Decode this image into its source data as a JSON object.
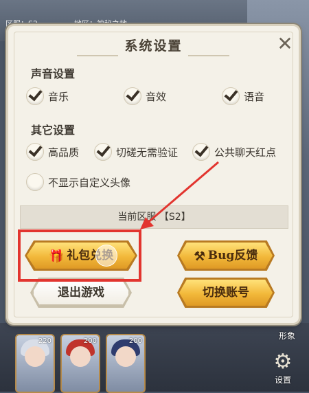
{
  "header": {
    "server_label": "区服：S2",
    "region_label": "地区：神秘之地"
  },
  "dialog": {
    "title": "系统设置",
    "close_label": "✕",
    "sound_section": "声音设置",
    "sound_options": [
      {
        "label": "音乐",
        "checked": true
      },
      {
        "label": "音效",
        "checked": true
      },
      {
        "label": "语音",
        "checked": true
      }
    ],
    "other_section": "其它设置",
    "other_options": [
      {
        "label": "高品质",
        "checked": true
      },
      {
        "label": "切磋无需验证",
        "checked": true
      },
      {
        "label": "公共聊天红点",
        "checked": true
      },
      {
        "label": "不显示自定义头像",
        "checked": false
      }
    ],
    "current_server": "当前区服 【S2】",
    "buttons": {
      "gift_redeem": "礼包兑换",
      "bug_feedback": "Bug反馈",
      "exit_game": "退出游戏",
      "switch_account": "切换账号"
    }
  },
  "heroes": [
    {
      "count": "220",
      "hair_color": "#d9dee8"
    },
    {
      "count": "200",
      "hair_color": "#c0332b"
    },
    {
      "count": "200",
      "hair_color": "#2f3c6e"
    }
  ],
  "side": {
    "label": "形象",
    "settings_label": "设置"
  },
  "icons": {
    "gift": "gift-icon",
    "tools": "wrench-screwdriver-icon",
    "gear": "gear-icon",
    "close": "close-icon"
  },
  "colors": {
    "highlight": "#e2352f",
    "gold_button": "#f2b83a",
    "dialog_bg": "#f4f1e8"
  }
}
